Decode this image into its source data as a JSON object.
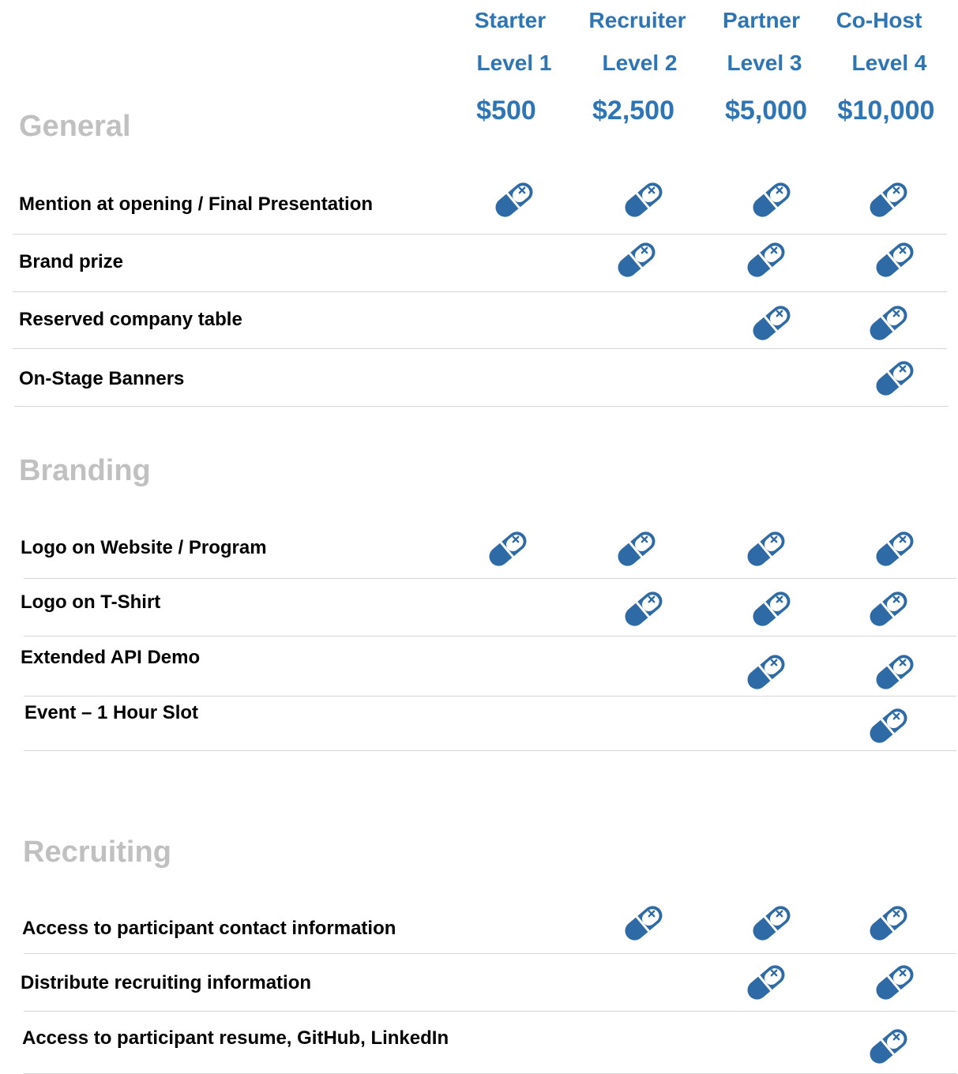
{
  "tiers": [
    {
      "name": "Starter",
      "level": "Level 1",
      "price": "$500"
    },
    {
      "name": "Recruiter",
      "level": "Level 2",
      "price": "$2,500"
    },
    {
      "name": "Partner",
      "level": "Level 3",
      "price": "$5,000"
    },
    {
      "name": "Co-Host",
      "level": "Level 4",
      "price": "$10,000"
    }
  ],
  "sections": [
    {
      "title": "General",
      "rows": [
        {
          "label": "Mention at opening / Final Presentation",
          "included": [
            true,
            true,
            true,
            true
          ]
        },
        {
          "label": "Brand prize",
          "included": [
            false,
            true,
            true,
            true
          ]
        },
        {
          "label": "Reserved company table",
          "included": [
            false,
            false,
            true,
            true
          ]
        },
        {
          "label": "On-Stage Banners",
          "included": [
            false,
            false,
            false,
            true
          ]
        }
      ]
    },
    {
      "title": "Branding",
      "rows": [
        {
          "label": "Logo on Website / Program",
          "included": [
            true,
            true,
            true,
            true
          ]
        },
        {
          "label": "Logo on T-Shirt",
          "included": [
            false,
            true,
            true,
            true
          ]
        },
        {
          "label": "Extended API Demo",
          "included": [
            false,
            false,
            true,
            true
          ]
        },
        {
          "label": "Event – 1 Hour Slot",
          "included": [
            false,
            false,
            false,
            true
          ]
        }
      ]
    },
    {
      "title": "Recruiting",
      "rows": [
        {
          "label": "Access to participant contact information",
          "included": [
            false,
            true,
            true,
            true
          ]
        },
        {
          "label": "Distribute recruiting information",
          "included": [
            false,
            false,
            true,
            true
          ]
        },
        {
          "label": "Access to participant resume, GitHub, LinkedIn",
          "included": [
            false,
            false,
            false,
            true
          ]
        }
      ]
    }
  ],
  "icon": "pill-icon",
  "colors": {
    "accent": "#2e75b6",
    "section_title": "#c0c0c0",
    "divider": "#d6d6d6",
    "icon": "#2e6aa6"
  }
}
